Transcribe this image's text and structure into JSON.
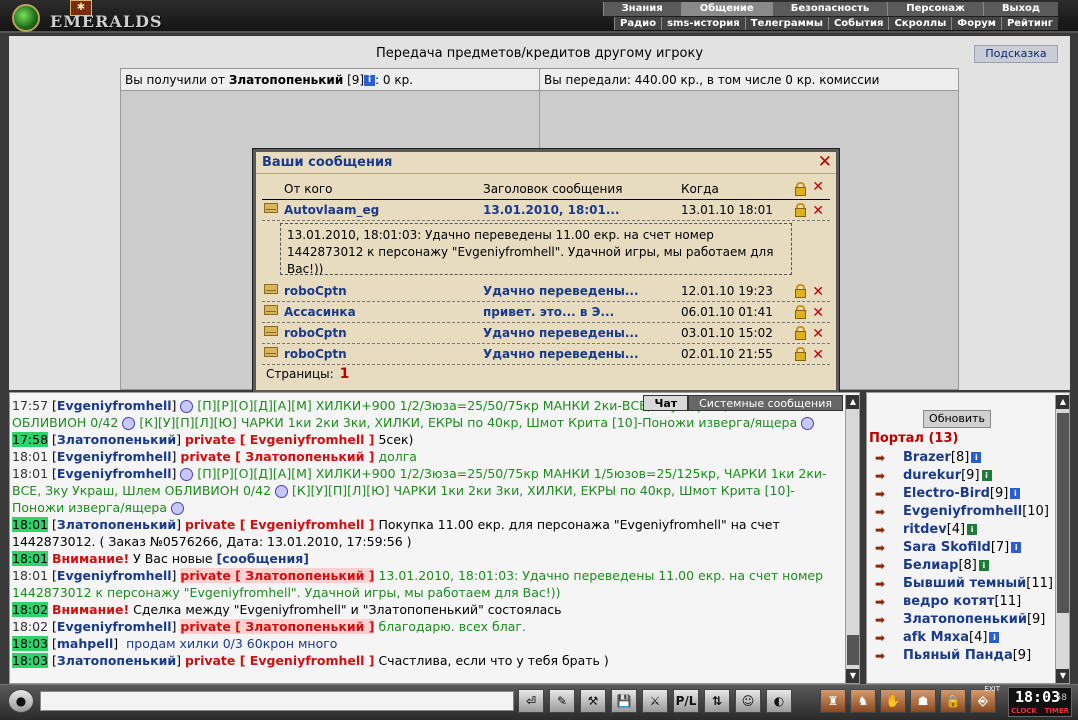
{
  "logo": {
    "word": "EMERALDS",
    "tag": "✱"
  },
  "menu_top": [
    "Знания",
    "Общение",
    "Безопасность",
    "Персонаж",
    "Выход"
  ],
  "menu_top_active": "Общение",
  "menu_sub": [
    "Радио",
    "sms-история",
    "Телеграммы",
    "События",
    "Скроллы",
    "Форум",
    "Рейтинг"
  ],
  "main": {
    "title": "Передача предметов/кредитов другому игроку",
    "hint_button": "Подсказка",
    "left_head_prefix": "Вы получили от",
    "left_head_name": "Златопопенький",
    "left_head_level": "[9]",
    "left_head_suffix": ": 0 кр.",
    "right_head": "Вы передали: 440.00 кр., в том числе 0 кр. комиссии"
  },
  "dialog": {
    "title": "Ваши сообщения",
    "col_from": "От кого",
    "col_subject": "Заголовок сообщения",
    "col_when": "Когда",
    "open": {
      "from": "Autovlaam_eg",
      "subject": "13.01.2010, 18:01...",
      "when": "13.01.10 18:01",
      "body": "13.01.2010, 18:01:03: Удачно переведены 11.00 екр. на счет номер 1442873012 к персонажу \"Evgeniyfromhell\". Удачной игры, мы работаем для Вас!))"
    },
    "rows": [
      {
        "from": "roboCptn",
        "subject": "Удачно переведены...",
        "when": "12.01.10 19:23"
      },
      {
        "from": "Ассасинка",
        "subject": "привет. это... в Э...",
        "when": "06.01.10 01:41"
      },
      {
        "from": "roboCptn",
        "subject": "Удачно переведены...",
        "when": "03.01.10 15:02"
      },
      {
        "from": "roboCptn",
        "subject": "Удачно переведены...",
        "when": "02.01.10 21:55"
      }
    ],
    "pages_label": "Страницы:",
    "pages_value": "1"
  },
  "chat": {
    "tabs": [
      "Чат",
      "Системные сообщения"
    ],
    "active_tab": "Чат",
    "lines": [
      {
        "time": "17:57",
        "hl": false,
        "nick": "Evgeniyfromhell",
        "parts": [
          [
            "smile",
            ""
          ],
          [
            "green",
            " [П][Р][О][Д][А][М] ХИЛКИ+900 1/2/Зюза=25/50/75кр МАНКИ 2ки-ВСЕ, Зку Украш, Шлем ОБЛИВИОН 0/42 "
          ],
          [
            "smile",
            ""
          ],
          [
            "green",
            " [К][У][П][Л][Ю] ЧАРКИ 1ки 2ки 3ки, ХИЛКИ, ЕКРЫ по 40кр, Шмот Крита [10]-Поножи изверга/ящера "
          ],
          [
            "smile",
            ""
          ]
        ]
      },
      {
        "time": "17:58",
        "hl": true,
        "nick": "Златопопенький",
        "parts": [
          [
            "priv",
            "private [ Evgeniyfromhell ]"
          ],
          [
            "plain",
            " 5сек)"
          ]
        ]
      },
      {
        "time": "18:01",
        "hl": false,
        "nick": "Evgeniyfromhell",
        "parts": [
          [
            "priv",
            "private [ Златопопенький ]"
          ],
          [
            "green",
            " долга"
          ]
        ]
      },
      {
        "time": "18:01",
        "hl": false,
        "nick": "Evgeniyfromhell",
        "parts": [
          [
            "smile",
            ""
          ],
          [
            "green",
            " [П][Р][О][Д][А][М] ХИЛКИ+900 1/2/Зюза=25/50/75кр МАНКИ 1/5юзов=25/125кр, ЧАРКИ 1ки 2ки-ВСЕ, Зку Украш, Шлем ОБЛИВИОН 0/42 "
          ],
          [
            "smile",
            ""
          ],
          [
            "green",
            " [К][У][П][Л][Ю] ЧАРКИ 1ки 2ки 3ки, ХИЛКИ, ЕКРЫ по 40кр, Шмот Крита [10]-Поножи изверга/ящера "
          ],
          [
            "smile",
            ""
          ]
        ]
      },
      {
        "time": "18:01",
        "hl": true,
        "nick": "Златопопенький",
        "parts": [
          [
            "priv",
            "private [ Evgeniyfromhell ]"
          ],
          [
            "plain",
            " Покупка 11.00 екр. для персонажа \"Evgeniyfromhell\" на счет 1442873012. ( Заказ №0576266, Дата: 13.01.2010, 17:59:56 )"
          ]
        ]
      },
      {
        "time": "18:01",
        "hl": true,
        "nick": "",
        "parts": [
          [
            "priv_plain",
            "Внимание!"
          ],
          [
            "plain",
            " У Вас новые "
          ],
          [
            "bluebold",
            "[сообщения]"
          ]
        ]
      },
      {
        "time": "18:01",
        "hl": false,
        "nick": "Evgeniyfromhell",
        "parts": [
          [
            "privbg",
            "private [ Златопопенький ]"
          ],
          [
            "green",
            " 13.01.2010, 18:01:03: Удачно переведены 11.00 екр. на счет номер 1442873012 к персонажу \"Evgeniyfromhell\". Удачной игры, мы работаем для Вас!))"
          ]
        ]
      },
      {
        "time": "18:02",
        "hl": true,
        "nick": "",
        "parts": [
          [
            "priv_plain",
            "Внимание!"
          ],
          [
            "plain",
            " Сделка между \"Evgeniyfromhell\" и \"Златопопенький\" состоялась"
          ]
        ]
      },
      {
        "time": "18:02",
        "hl": false,
        "nick": "Evgeniyfromhell",
        "parts": [
          [
            "privbg",
            "private [ Златопопенький ]"
          ],
          [
            "green",
            " благодарю. всех благ."
          ]
        ]
      },
      {
        "time": "18:03",
        "hl": true,
        "nick": "mahpell",
        "parts": [
          [
            "blue",
            " продам хилки 0/3 60крон много"
          ]
        ]
      },
      {
        "time": "18:03",
        "hl": true,
        "nick": "Златопопенький",
        "parts": [
          [
            "priv",
            "private [ Evgeniyfromhell ]"
          ],
          [
            "plain",
            " Счастлива, если что у тебя брать )"
          ]
        ]
      }
    ]
  },
  "users": {
    "refresh_button": "Обновить",
    "portal_label": "Портал (13)",
    "list": [
      {
        "name": "Brazer",
        "level": "[8]",
        "info": "b"
      },
      {
        "name": "durekur",
        "level": "[9]",
        "info": "g"
      },
      {
        "name": "Electro-Bird",
        "level": "[9]",
        "info": "b"
      },
      {
        "name": "Evgeniyfromhell",
        "level": "[10]",
        "info": ""
      },
      {
        "name": "ritdev",
        "level": "[4]",
        "info": "g"
      },
      {
        "name": "Sara Skofild",
        "level": "[7]",
        "info": "b"
      },
      {
        "name": "Белиар",
        "level": "[8]",
        "info": "g"
      },
      {
        "name": "Бывший темный",
        "level": "[11]",
        "info": ""
      },
      {
        "name": "ведро котят",
        "level": "[11]",
        "info": ""
      },
      {
        "name": "Златопопенький",
        "level": "[9]",
        "info": ""
      },
      {
        "name": "afk Мяха",
        "level": "[4]",
        "info": "b"
      },
      {
        "name": "Пьяный Панда",
        "level": "[9]",
        "info": ""
      }
    ]
  },
  "bottom": {
    "input_placeholder": "",
    "tools": [
      "⏎",
      "✎",
      "⚒",
      "💾",
      "⚔",
      "P/L",
      "⇅",
      "☺",
      "◐"
    ],
    "tools_right": [
      "♜",
      "♞",
      "✋",
      "☗",
      "🔒",
      "⎆"
    ],
    "exit_label": "EXIT",
    "clock_time": "18:03",
    "clock_sec": "58",
    "clock_label": "CLOCK",
    "timer_label": "TIMER"
  }
}
